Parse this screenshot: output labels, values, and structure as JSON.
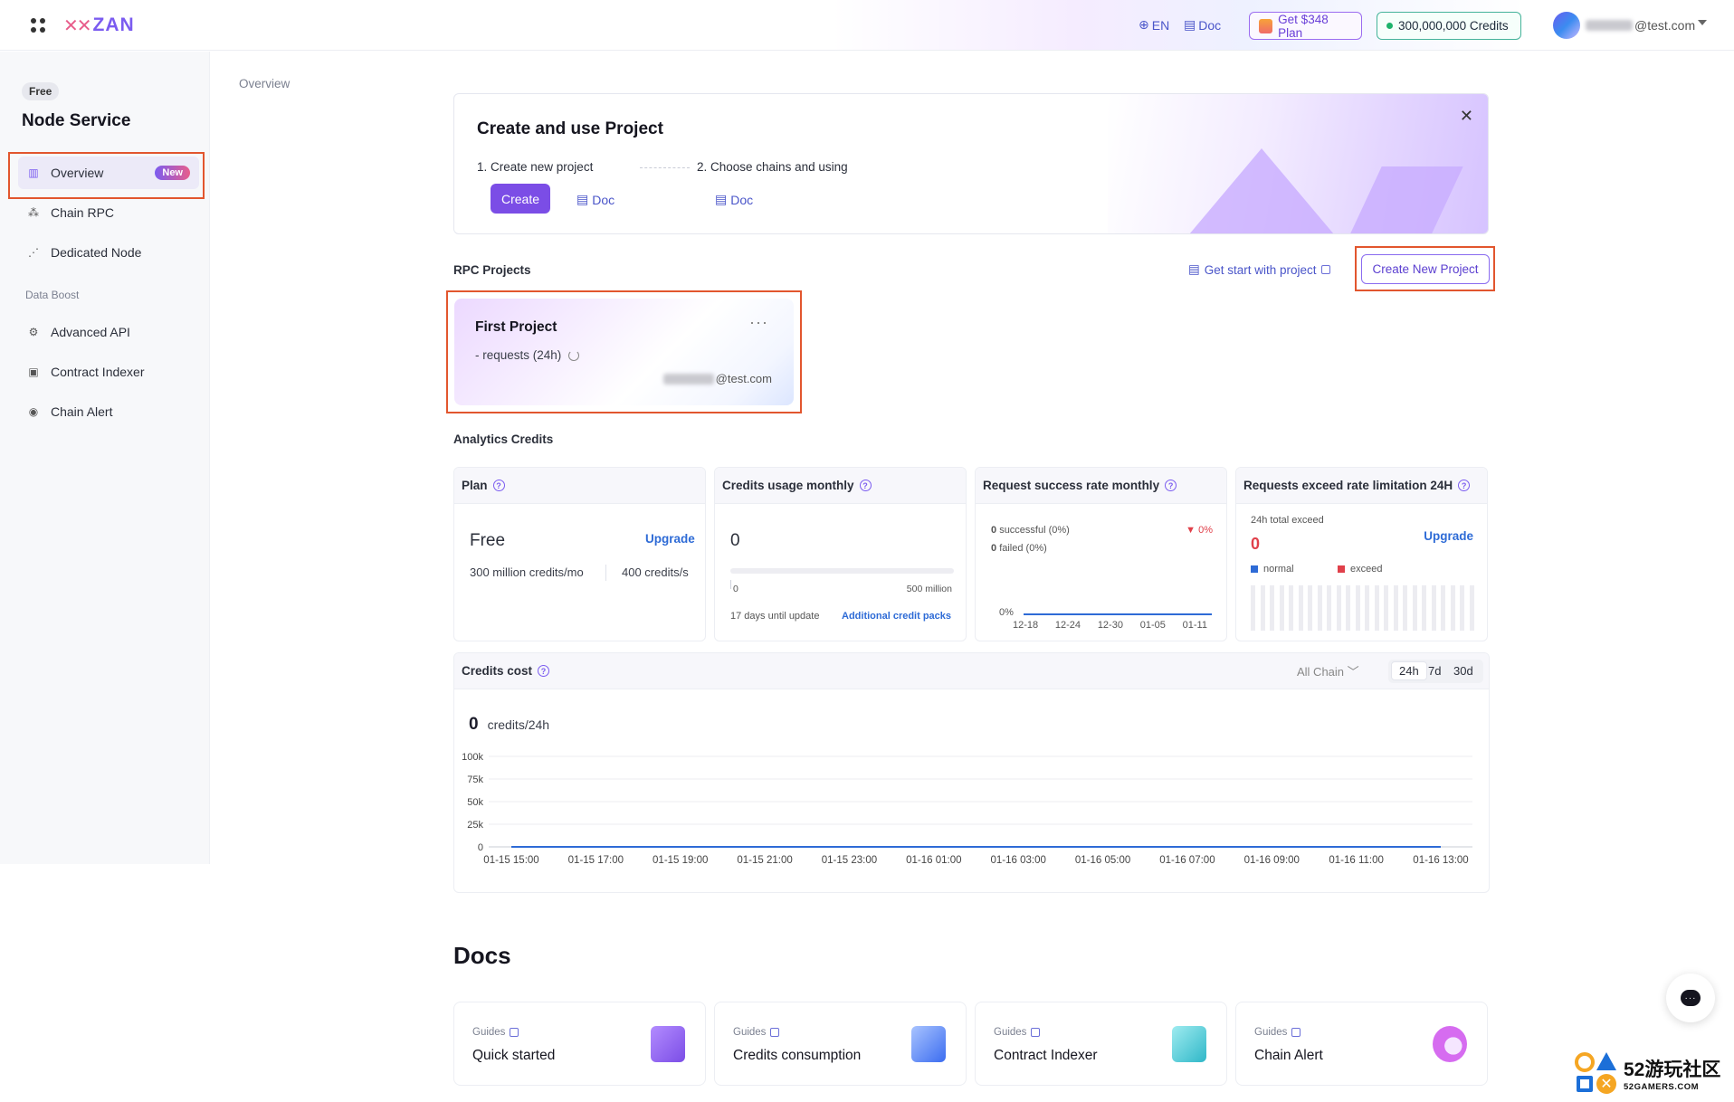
{
  "topbar": {
    "logo_text": "ZAN",
    "lang": "EN",
    "doc": "Doc",
    "plan_button": "Get $348 Plan",
    "credits_button": "300,000,000 Credits",
    "user_email_suffix": "@test.com"
  },
  "sidebar": {
    "badge": "Free",
    "title": "Node Service",
    "items": [
      {
        "label": "Overview",
        "icon": "chart-icon",
        "badge": "New"
      },
      {
        "label": "Chain RPC",
        "icon": "nodes-icon"
      },
      {
        "label": "Dedicated Node",
        "icon": "graph-icon"
      }
    ],
    "section_label": "Data Boost",
    "boost_items": [
      {
        "label": "Advanced API",
        "icon": "gear-icon"
      },
      {
        "label": "Contract Indexer",
        "icon": "code-icon"
      },
      {
        "label": "Chain Alert",
        "icon": "alert-icon"
      }
    ]
  },
  "breadcrumb": "Overview",
  "banner": {
    "title": "Create and use Project",
    "step1": "1. Create new project",
    "step2": "2. Choose chains and using",
    "create_button": "Create",
    "doc_link": "Doc"
  },
  "rpc": {
    "section_title": "RPC Projects",
    "get_start": "Get start with project",
    "new_project": "Create New Project",
    "project": {
      "name": "First Project",
      "requests": "- requests (24h)",
      "owner_suffix": "@test.com"
    }
  },
  "analytics": {
    "section_title": "Analytics Credits",
    "plan": {
      "title": "Plan",
      "name": "Free",
      "upgrade": "Upgrade",
      "credits": "300 million credits/mo",
      "rate": "400 credits/s"
    },
    "usage": {
      "title": "Credits usage monthly",
      "value": "0",
      "min": "0",
      "max": "500 million",
      "until": "17 days until update",
      "packs": "Additional credit packs",
      "fraction_used": 0
    },
    "success": {
      "title": "Request success rate monthly",
      "successful": "successful (0%)",
      "successful_count": "0",
      "failed": "failed (0%)",
      "failed_count": "0",
      "change": "0%",
      "y_label": "0%",
      "x_labels": [
        "12-18",
        "12-24",
        "12-30",
        "01-05",
        "01-11"
      ]
    },
    "exceed": {
      "title": "Requests exceed rate limitation 24H",
      "subtitle": "24h total exceed",
      "value": "0",
      "upgrade": "Upgrade",
      "legend_normal": "normal",
      "legend_exceed": "exceed",
      "normal_color": "#2e6bd6",
      "exceed_color": "#e0404a"
    }
  },
  "credits_cost": {
    "title": "Credits cost",
    "chain_filter": "All Chain",
    "ranges": [
      "24h",
      "7d",
      "30d"
    ],
    "active_range": "24h",
    "value": "0",
    "unit": "credits/24h"
  },
  "chart_data": {
    "type": "line",
    "x": [
      "01-15 15:00",
      "01-15 17:00",
      "01-15 19:00",
      "01-15 21:00",
      "01-15 23:00",
      "01-16 01:00",
      "01-16 03:00",
      "01-16 05:00",
      "01-16 07:00",
      "01-16 09:00",
      "01-16 11:00",
      "01-16 13:00"
    ],
    "yticks": [
      "0",
      "25k",
      "50k",
      "75k",
      "100k"
    ],
    "ylim": [
      0,
      100000
    ],
    "series": [
      {
        "values": [
          0,
          0,
          0,
          0,
          0,
          0,
          0,
          0,
          0,
          0,
          0,
          0
        ]
      }
    ],
    "grid": true,
    "color": "#2e6bd6"
  },
  "docs": {
    "title": "Docs",
    "cards": [
      {
        "tag": "Guides",
        "name": "Quick started",
        "icon": "quick-start-icon",
        "color": "#9b6cf0"
      },
      {
        "tag": "Guides",
        "name": "Credits consumption",
        "icon": "credits-chart-icon",
        "color": "#4a7cf0"
      },
      {
        "tag": "Guides",
        "name": "Contract Indexer",
        "icon": "contract-indexer-icon",
        "color": "#35c5d0"
      },
      {
        "tag": "Guides",
        "name": "Chain Alert",
        "icon": "chain-alert-icon",
        "color": "#d66cf0"
      }
    ]
  },
  "watermark": {
    "big": "52游玩社区",
    "small": "52GAMERS.COM"
  }
}
